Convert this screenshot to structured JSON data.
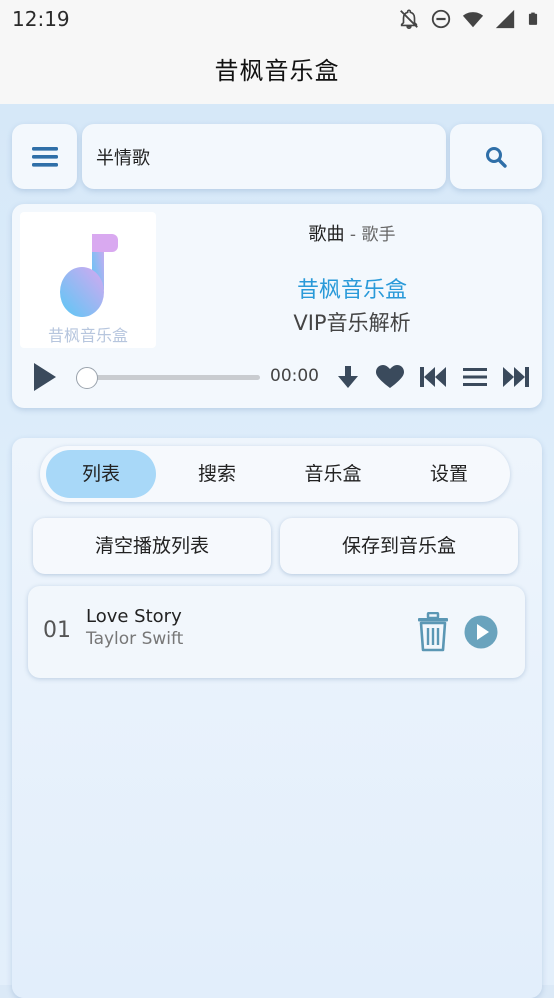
{
  "status_bar": {
    "time": "12:19",
    "icons": [
      "notifications-off-icon",
      "do-not-disturb-icon",
      "wifi-icon",
      "signal-icon",
      "battery-icon"
    ]
  },
  "app": {
    "title": "昔枫音乐盒"
  },
  "search": {
    "value": "半情歌"
  },
  "player": {
    "song": "歌曲",
    "separator": " - ",
    "artist": "歌手",
    "cover_text": "昔枫音乐盒",
    "brand_name": "昔枫音乐盒",
    "brand_subtitle": "VIP音乐解析",
    "time": "00:00",
    "progress": 0
  },
  "tabs": [
    {
      "label": "列表",
      "active": true
    },
    {
      "label": "搜索",
      "active": false
    },
    {
      "label": "音乐盒",
      "active": false
    },
    {
      "label": "设置",
      "active": false
    }
  ],
  "actions": {
    "clear_label": "清空播放列表",
    "save_label": "保存到音乐盒"
  },
  "playlist": [
    {
      "index": "01",
      "title": "Love Story",
      "artist": "Taylor Swift"
    }
  ],
  "colors": {
    "accent": "#2a9ad9",
    "icon_blue": "#2f6fa8",
    "icon_dark": "#3a4a5c",
    "tab_active": "#a8d8f8",
    "list_icon": "#5b97b4"
  }
}
